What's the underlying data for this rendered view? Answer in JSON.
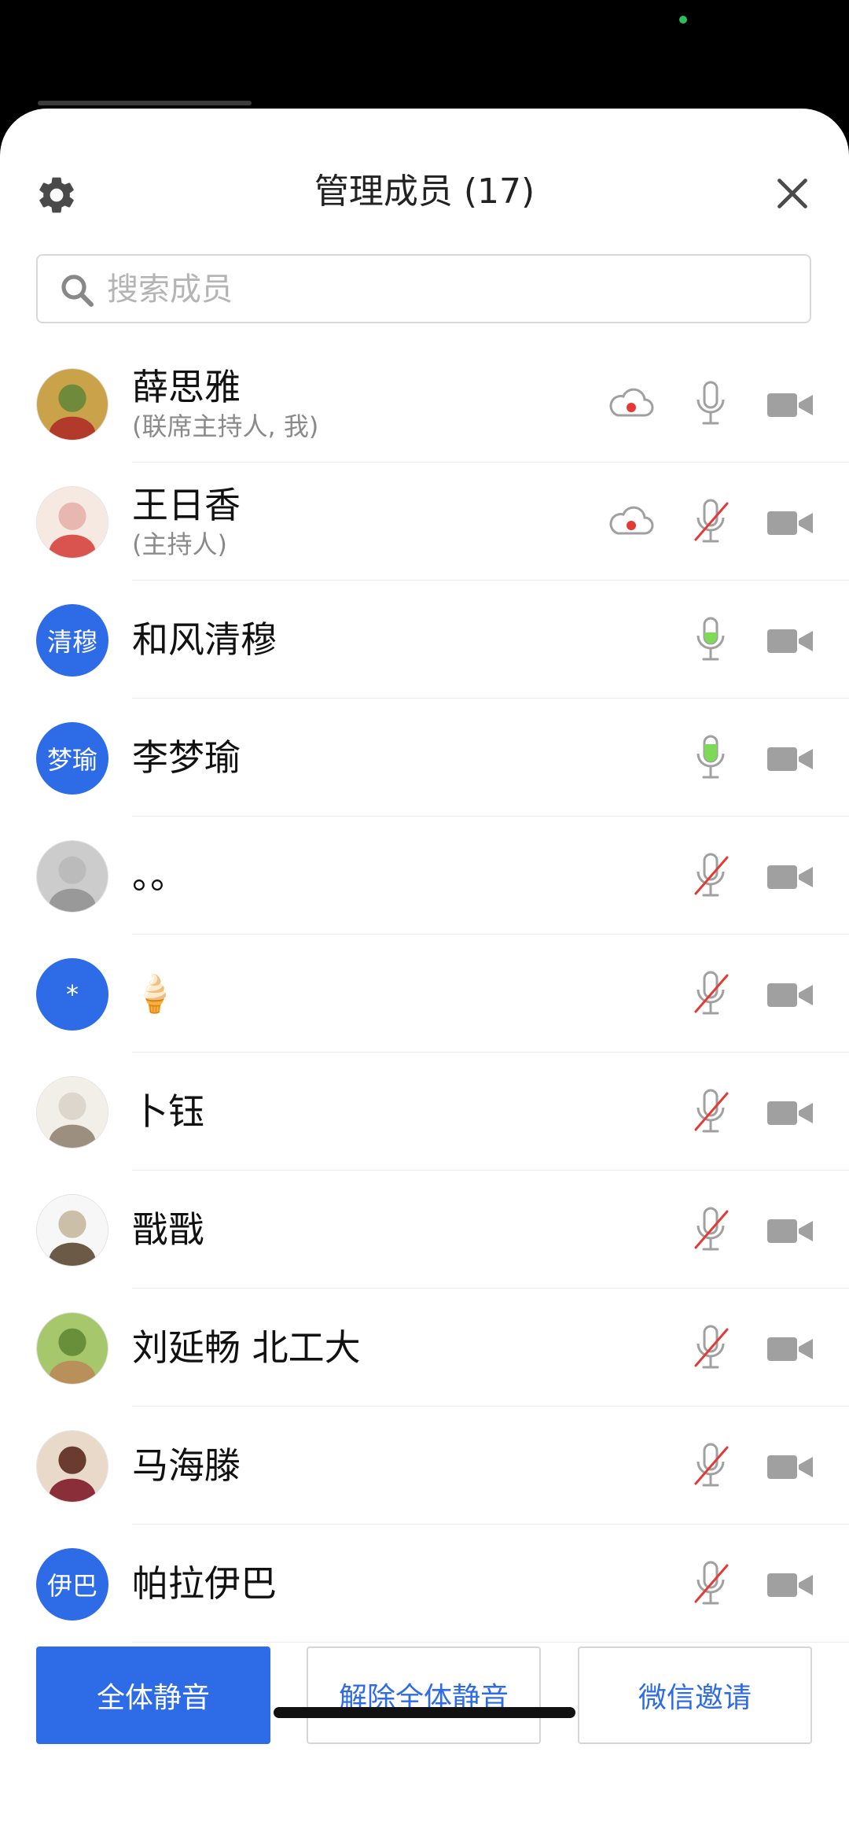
{
  "header": {
    "title": "管理成员 (17)"
  },
  "search": {
    "placeholder": "搜索成员",
    "value": ""
  },
  "members": [
    {
      "name": "薛思雅",
      "role": "(联席主持人, 我)",
      "avatar_type": "image",
      "recording": true,
      "mic": "on"
    },
    {
      "name": "王日香",
      "role": "(主持人)",
      "avatar_type": "image",
      "recording": true,
      "mic": "muted"
    },
    {
      "name": "和风清穆",
      "role": "",
      "avatar_type": "text",
      "avatar_text": "清穆",
      "recording": false,
      "mic": "speaking"
    },
    {
      "name": "李梦瑜",
      "role": "",
      "avatar_type": "text",
      "avatar_text": "梦瑜",
      "recording": false,
      "mic": "speaking-loud"
    },
    {
      "name": "。。",
      "role": "",
      "avatar_type": "image",
      "recording": false,
      "mic": "muted"
    },
    {
      "name": "🍦",
      "role": "",
      "avatar_type": "text",
      "avatar_text": "*",
      "recording": false,
      "mic": "muted"
    },
    {
      "name": "卜钰",
      "role": "",
      "avatar_type": "image",
      "recording": false,
      "mic": "muted"
    },
    {
      "name": "戬戬",
      "role": "",
      "avatar_type": "image",
      "recording": false,
      "mic": "muted"
    },
    {
      "name": "刘延畅 北工大",
      "role": "",
      "avatar_type": "image",
      "recording": false,
      "mic": "muted"
    },
    {
      "name": "马海滕",
      "role": "",
      "avatar_type": "image",
      "recording": false,
      "mic": "muted"
    },
    {
      "name": "帕拉伊巴",
      "role": "",
      "avatar_type": "text",
      "avatar_text": "伊巴",
      "recording": false,
      "mic": "muted"
    }
  ],
  "actions": {
    "mute_all": "全体静音",
    "unmute_all": "解除全体静音",
    "wechat_invite": "微信邀请"
  },
  "icons": {
    "settings": "gear-icon",
    "close": "close-icon",
    "search": "search-icon",
    "recording": "cloud-record-icon",
    "mic": "microphone-icon",
    "camera": "video-camera-icon"
  },
  "colors": {
    "accent": "#2e6be6",
    "record_dot": "#e53935",
    "speaking": "#7ed957",
    "muted_slash": "#e53935",
    "icon_gray": "#a0a0a0"
  }
}
